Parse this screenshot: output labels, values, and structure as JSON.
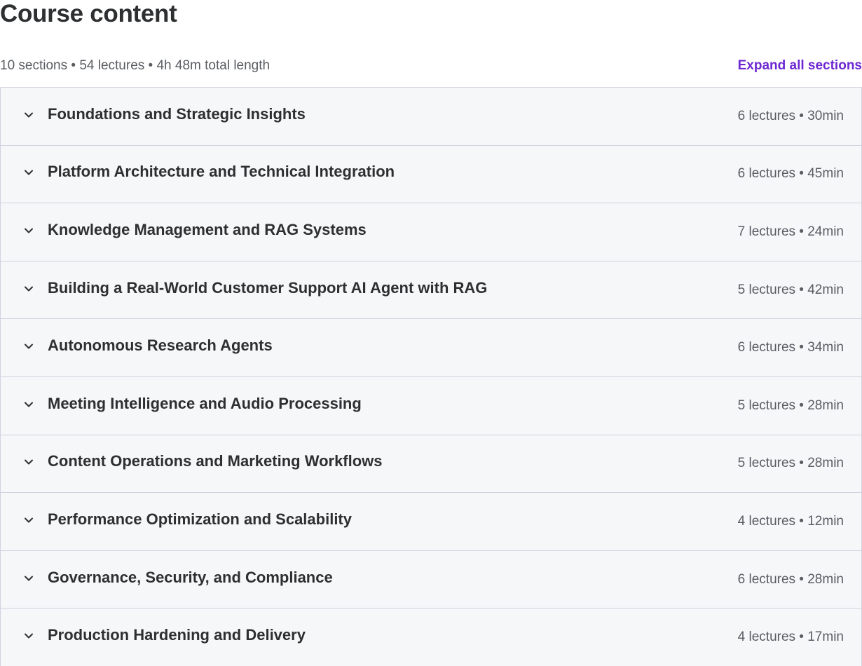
{
  "header": {
    "title": "Course content",
    "summary": "10 sections • 54 lectures • 4h 48m total length",
    "expand_all_label": "Expand all sections"
  },
  "icons": {
    "section_toggle": "chevron-down-icon"
  },
  "colors": {
    "accent": "#6d28d2",
    "section_bg": "#f6f7f9",
    "border": "#d1d2e0",
    "text": "#2d2f31",
    "muted_text": "#595c61"
  },
  "sections": [
    {
      "title": "Foundations and Strategic Insights",
      "meta": "6 lectures • 30min"
    },
    {
      "title": "Platform Architecture and Technical Integration",
      "meta": "6 lectures • 45min"
    },
    {
      "title": "Knowledge Management and RAG Systems",
      "meta": "7 lectures • 24min"
    },
    {
      "title": "Building a Real-World Customer Support AI Agent with RAG",
      "meta": "5 lectures • 42min"
    },
    {
      "title": "Autonomous Research Agents",
      "meta": "6 lectures • 34min"
    },
    {
      "title": "Meeting Intelligence and Audio Processing",
      "meta": "5 lectures • 28min"
    },
    {
      "title": "Content Operations and Marketing Workflows",
      "meta": "5 lectures • 28min"
    },
    {
      "title": "Performance Optimization and Scalability",
      "meta": "4 lectures • 12min"
    },
    {
      "title": "Governance, Security, and Compliance",
      "meta": "6 lectures • 28min"
    },
    {
      "title": "Production Hardening and Delivery",
      "meta": "4 lectures • 17min"
    }
  ]
}
